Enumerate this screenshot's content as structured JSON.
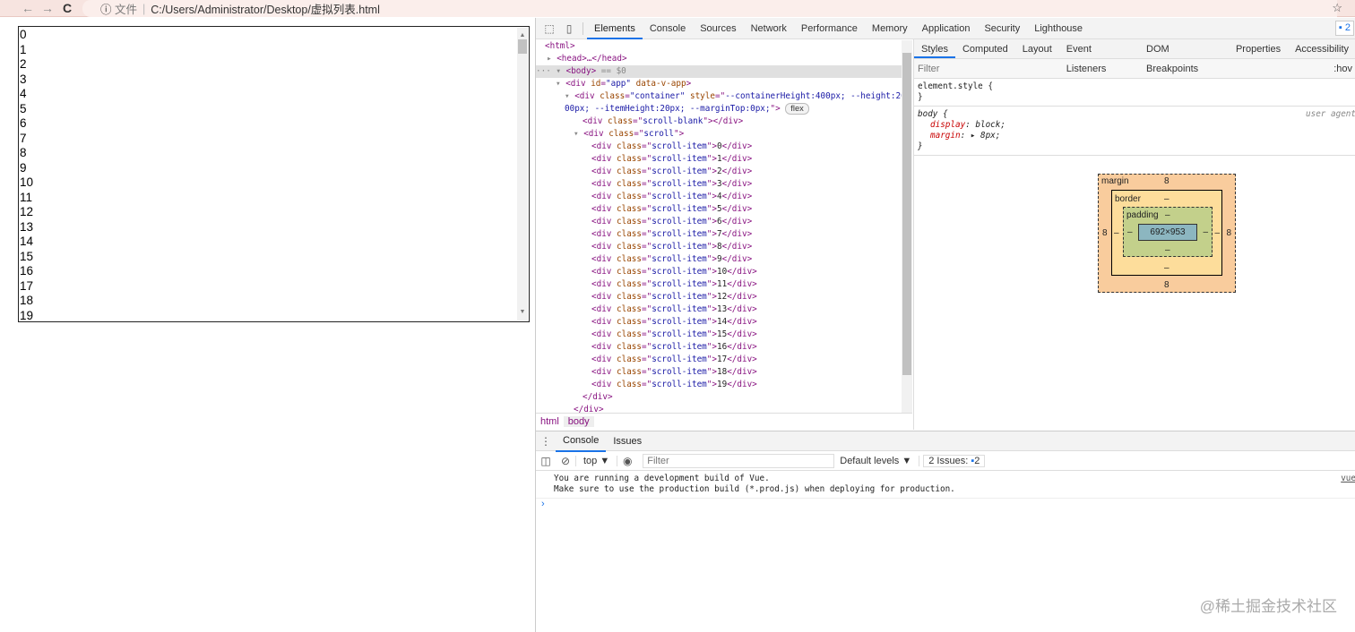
{
  "browser": {
    "back": "←",
    "forward": "→",
    "reload": "C",
    "info": "ⓘ",
    "file_label": "文件",
    "url": "C:/Users/Administrator/Desktop/虚拟列表.html",
    "star": "☆"
  },
  "list": {
    "items": [
      "0",
      "1",
      "2",
      "3",
      "4",
      "5",
      "6",
      "7",
      "8",
      "9",
      "10",
      "11",
      "12",
      "13",
      "14",
      "15",
      "16",
      "17",
      "18",
      "19"
    ]
  },
  "devtools": {
    "tabs": [
      "Elements",
      "Console",
      "Sources",
      "Network",
      "Performance",
      "Memory",
      "Application",
      "Security",
      "Lighthouse"
    ],
    "active_tab": "Elements",
    "issues_badge": "2",
    "dom": {
      "html": "<html>",
      "head": "<head>…</head>",
      "body": "<body>",
      "body_sel": " == $0",
      "app": [
        "div",
        "id",
        "app",
        "data-v-app"
      ],
      "container_style1": "--containerHeight:400px; --height:200",
      "container_style2": "00px; --itemHeight:20px; --marginTop:0px;",
      "flex_badge": "flex",
      "blank_class": "scroll-blank",
      "scroll_class": "scroll",
      "item_class": "scroll-item",
      "items": [
        "0",
        "1",
        "2",
        "3",
        "4",
        "5",
        "6",
        "7",
        "8",
        "9",
        "10",
        "11",
        "12",
        "13",
        "14",
        "15",
        "16",
        "17",
        "18",
        "19"
      ],
      "close": "</div>"
    },
    "breadcrumbs": [
      "html",
      "body"
    ],
    "styles": {
      "tabs": [
        "Styles",
        "Computed",
        "Layout",
        "Event Listeners",
        "DOM Breakpoints",
        "Properties",
        "Accessibility"
      ],
      "filter_placeholder": "Filter",
      "hov": ":hov",
      "element_style": "element.style {",
      "close_brace": "}",
      "body_selector": "body {",
      "source": "user agent",
      "props": [
        {
          "name": "display",
          "value": "block;"
        },
        {
          "name": "margin",
          "value": "▸ 8px;"
        }
      ]
    },
    "box_model": {
      "margin_label": "margin",
      "border_label": "border",
      "padding_label": "padding",
      "margin": "8",
      "border": "–",
      "padding": "–",
      "content": "692×953"
    },
    "console": {
      "tabs": [
        "Console",
        "Issues"
      ],
      "context": "top ▼",
      "filter_placeholder": "Filter",
      "levels": "Default levels ▼",
      "issues": "2 Issues:",
      "issues_count": "2",
      "messages": [
        "You are running a development build of Vue.",
        "Make sure to use the production build (*.prod.js) when deploying for production."
      ],
      "source": "vue",
      "prompt": "›"
    }
  },
  "watermark": "@稀土掘金技术社区"
}
